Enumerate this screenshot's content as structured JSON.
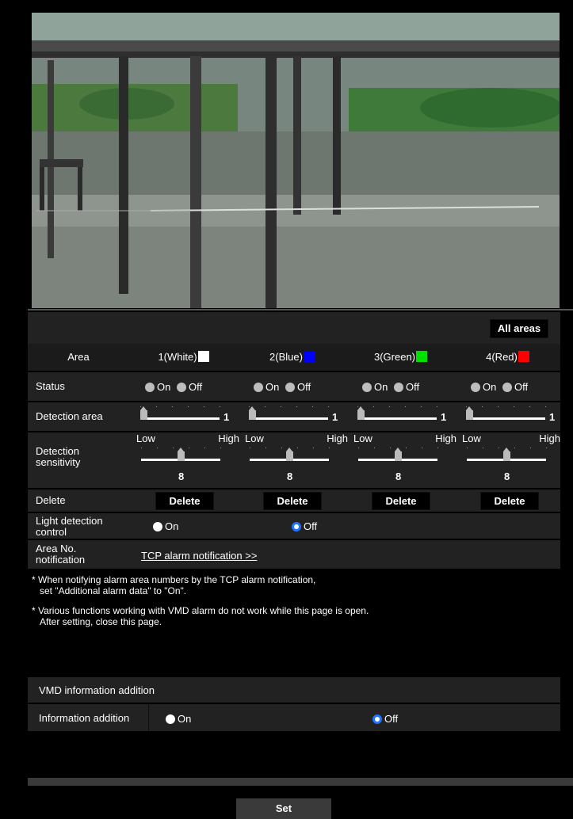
{
  "camera": {
    "alt": "camera-view"
  },
  "all_areas_button": "All areas",
  "header": {
    "area_label": "Area",
    "areas": [
      {
        "label": "1(White)",
        "color": "#ffffff"
      },
      {
        "label": "2(Blue)",
        "color": "#0000ff"
      },
      {
        "label": "3(Green)",
        "color": "#00e000"
      },
      {
        "label": "4(Red)",
        "color": "#ff0000"
      }
    ]
  },
  "status": {
    "label": "Status",
    "on": "On",
    "off": "Off"
  },
  "detection_area": {
    "label": "Detection area",
    "values": [
      "1",
      "1",
      "1",
      "1"
    ]
  },
  "sensitivity": {
    "label": "Detection sensitivity",
    "low": "Low",
    "high": "High",
    "values": [
      "8",
      "8",
      "8",
      "8"
    ]
  },
  "delete": {
    "label": "Delete",
    "button": "Delete"
  },
  "light_detection": {
    "label": "Light detection control",
    "on": "On",
    "off": "Off",
    "selected": "Off"
  },
  "area_notification": {
    "label": "Area No. notification",
    "link": "TCP alarm notification >>"
  },
  "notes": [
    "* When notifying alarm area numbers by the TCP alarm notification,",
    "set \"Additional alarm data\" to \"On\".",
    "* Various functions working with VMD alarm do not work while this page is open.",
    "After setting, close this page."
  ],
  "vmd_info": {
    "title": "VMD information addition",
    "label": "Information addition",
    "on": "On",
    "off": "Off",
    "selected": "Off"
  },
  "set_button": "Set"
}
